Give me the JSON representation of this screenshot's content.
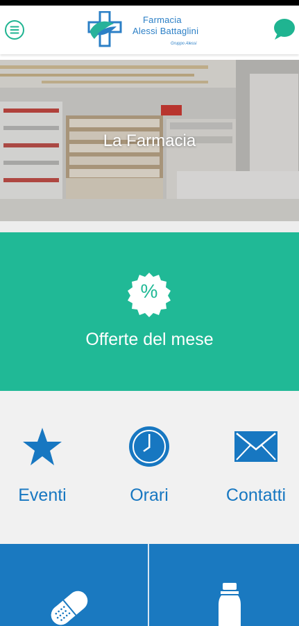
{
  "header": {
    "logo": {
      "line1": "Farmacia",
      "line2": "Alessi Battaglini",
      "line3": "Gruppo Alessi",
      "color_blue": "#2b7fc6",
      "color_green": "#27b29a"
    },
    "menu_icon": "hamburger-menu-icon",
    "chat_icon": "speech-bubble-icon",
    "accent": "#1fb491"
  },
  "hero": {
    "title": "La Farmacia"
  },
  "offers": {
    "label": "Offerte del mese",
    "badge_symbol": "%",
    "background": "#20b996"
  },
  "shortcuts": [
    {
      "label": "Eventi",
      "icon": "star-icon"
    },
    {
      "label": "Orari",
      "icon": "clock-icon"
    },
    {
      "label": "Contatti",
      "icon": "envelope-icon"
    }
  ],
  "tiles": [
    {
      "icon": "pill-capsule-icon"
    },
    {
      "icon": "bottle-icon"
    }
  ],
  "colors": {
    "primary_blue": "#1777c1",
    "tile_blue": "#1a79c0",
    "shortcut_bg": "#f1f1f1"
  }
}
